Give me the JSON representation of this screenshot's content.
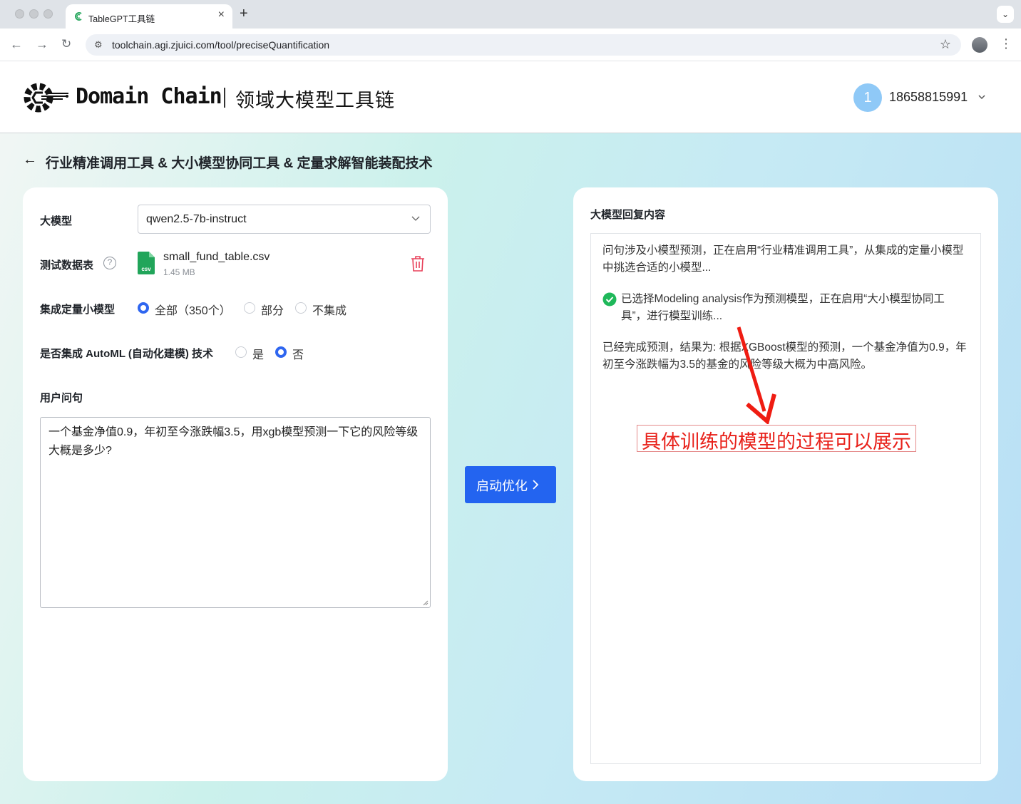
{
  "browser": {
    "tab_title": "TableGPT工具链",
    "url": "toolchain.agi.zjuici.com/tool/preciseQuantification"
  },
  "header": {
    "brand": "Domain Chain",
    "brand_cn": "领域大模型工具链",
    "avatar_letter": "1",
    "username": "18658815991"
  },
  "page": {
    "title": "行业精准调用工具 & 大小模型协同工具 & 定量求解智能装配技术"
  },
  "form": {
    "model_label": "大模型",
    "model_value": "qwen2.5-7b-instruct",
    "dataset_label": "测试数据表",
    "help_glyph": "?",
    "file_name": "small_fund_table.csv",
    "file_size": "1.45 MB",
    "file_badge": "csv",
    "small_model_label": "集成定量小模型",
    "small_model_options": [
      "全部（350个）",
      "部分",
      "不集成"
    ],
    "small_model_selected": 0,
    "automl_label": "是否集成 AutoML (自动化建模) 技术",
    "automl_options": [
      "是",
      "否"
    ],
    "automl_selected": 1,
    "query_label": "用户问句",
    "query_text": "一个基金净值0.9，年初至今涨跌幅3.5，用xgb模型预测一下它的风险等级大概是多少?"
  },
  "action": {
    "run_label": "启动优化"
  },
  "response": {
    "title": "大模型回复内容",
    "line1": "问句涉及小模型预测，正在启用“行业精准调用工具”，从集成的定量小模型中挑选合适的小模型...",
    "line2": "已选择Modeling analysis作为预测模型，正在启用“大小模型协同工具”，进行模型训练...",
    "line3": "已经完成预测，结果为: 根据XGBoost模型的预测，一个基金净值为0.9，年初至今涨跌幅为3.5的基金的风险等级大概为中高风险。"
  },
  "annotation": {
    "text": "具体训练的模型的过程可以展示",
    "color": "#e8211a"
  },
  "colors": {
    "primary": "#2364f0",
    "success": "#1fb85a",
    "danger": "#e8415a"
  }
}
